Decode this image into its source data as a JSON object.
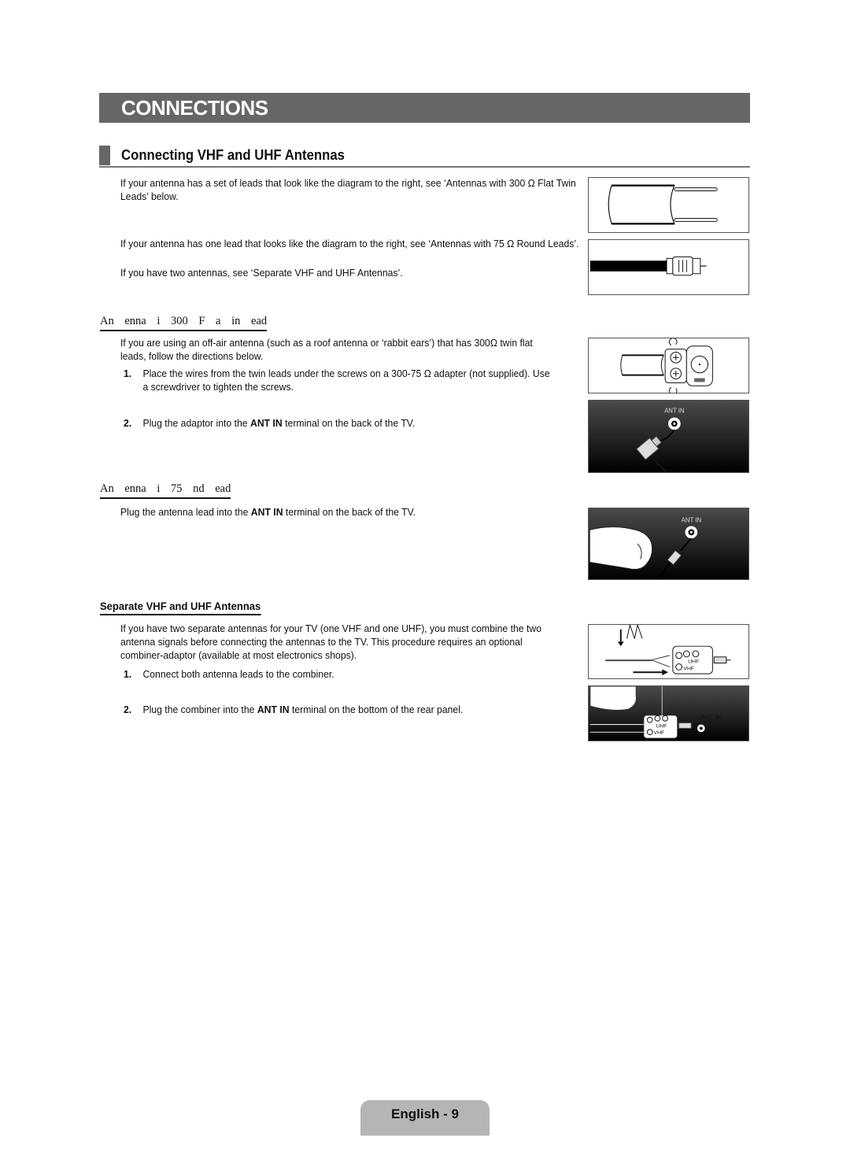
{
  "header": {
    "title": "CONNECTIONS"
  },
  "section": {
    "title": "Connecting VHF and UHF Antennas"
  },
  "intro": {
    "p1": "If your antenna has a set of leads that look like the diagram to the right, see ‘Antennas with 300 Ω Flat Twin Leads’ below.",
    "p2": "If your antenna has one lead that looks like the diagram to the right, see ‘Antennas with 75 Ω Round Leads’.",
    "p3": "If you have two antennas, see ‘Separate VHF and UHF Antennas’."
  },
  "flat_twin": {
    "heading": "An enna i 300 F a in ead",
    "intro": "If you are using an off-air antenna (such as a roof antenna or ‘rabbit ears’) that has 300Ω twin flat leads, follow the directions below.",
    "steps": [
      {
        "num": "1.",
        "pre": "Place the wires from the twin leads under the screws on a 300-75 Ω adapter (not supplied). Use a screwdriver to tighten the screws.",
        "bold": "",
        "post": ""
      },
      {
        "num": "2.",
        "pre": "Plug the adaptor into the ",
        "bold": "ANT IN",
        "post": " terminal on the back of the TV."
      }
    ],
    "figure_label": "ANT IN"
  },
  "round": {
    "heading": "An enna i 75 nd ead",
    "pre": "Plug the antenna lead into the ",
    "bold": "ANT IN",
    "post": " terminal on the back of the TV.",
    "figure_label": "ANT IN"
  },
  "separate": {
    "heading": "Separate VHF and UHF Antennas",
    "intro": "If you have two separate antennas for your TV (one VHF and one UHF), you must combine the two antenna signals before connecting the antennas to the TV. This procedure requires an optional combiner-adaptor (available at most electronics shops).",
    "steps": [
      {
        "num": "1.",
        "pre": "Connect both antenna leads to the combiner.",
        "bold": "",
        "post": ""
      },
      {
        "num": "2.",
        "pre": "Plug the combiner into the ",
        "bold": "ANT IN",
        "post": " terminal on the bottom of the rear panel."
      }
    ],
    "figure_labels": {
      "uhf": "UHF",
      "vhf": "VHF",
      "ant_in": "ANT IN"
    }
  },
  "footer": {
    "page_label": "English - 9"
  }
}
